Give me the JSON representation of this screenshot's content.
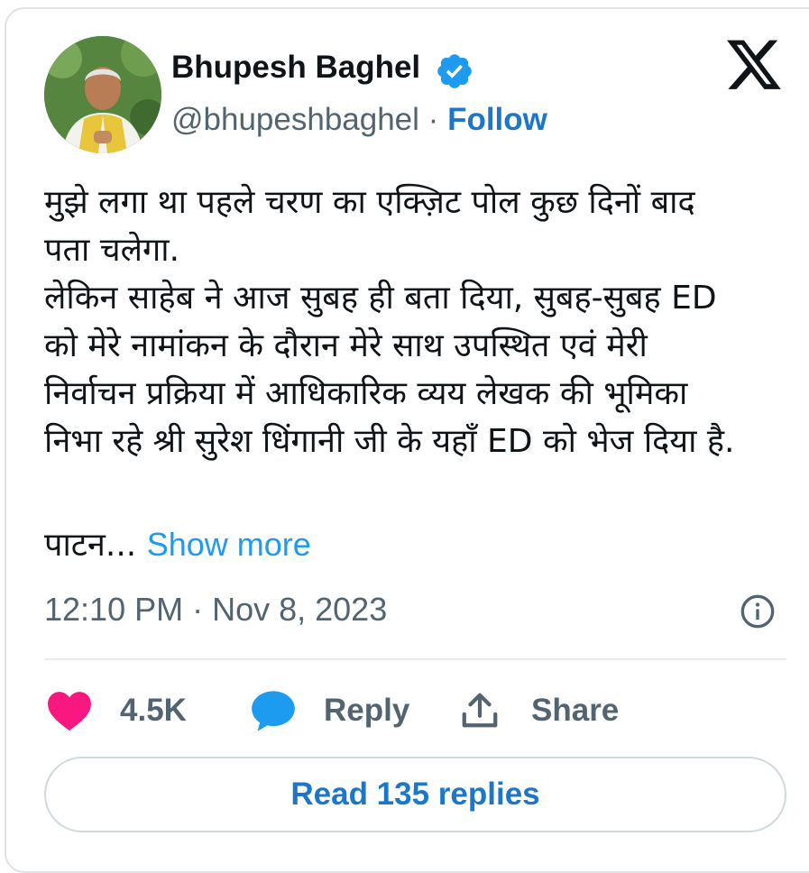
{
  "author": {
    "name": "Bhupesh Baghel",
    "handle": "@bhupeshbaghel",
    "separator": "·",
    "follow_label": "Follow",
    "verified_icon": "verified-badge-icon",
    "verified_color": "#1d9bf0"
  },
  "brand": {
    "logo_icon": "x-logo-icon"
  },
  "tweet": {
    "lines": [
      "मुझे लगा था पहले चरण का एक्ज़िट पोल कुछ दिनों बाद",
      "पता चलेगा.",
      "लेकिन साहेब ने आज सुबह ही बता दिया, सुबह-सुबह ED",
      "को मेरे नामांकन के दौरान मेरे साथ उपस्थित एवं मेरी",
      "निर्वाचन प्रक्रिया में आधिकारिक व्यय लेखक की भूमिका",
      "निभा रहे श्री सुरेश धिंगानी जी के यहाँ ED को भेज दिया है."
    ],
    "truncated_text": "पाटन...",
    "show_more_label": "Show more",
    "timestamp": "12:10 PM · Nov 8, 2023"
  },
  "actions": {
    "like_count": "4.5K",
    "reply_label": "Reply",
    "share_label": "Share",
    "like_color": "#f91880",
    "reply_color": "#1d9bf0"
  },
  "read_replies_label": "Read 135 replies",
  "colors": {
    "text_primary": "#0f1419",
    "text_secondary": "#536471",
    "link": "#1d9bf0",
    "follow": "#1d77c8"
  }
}
